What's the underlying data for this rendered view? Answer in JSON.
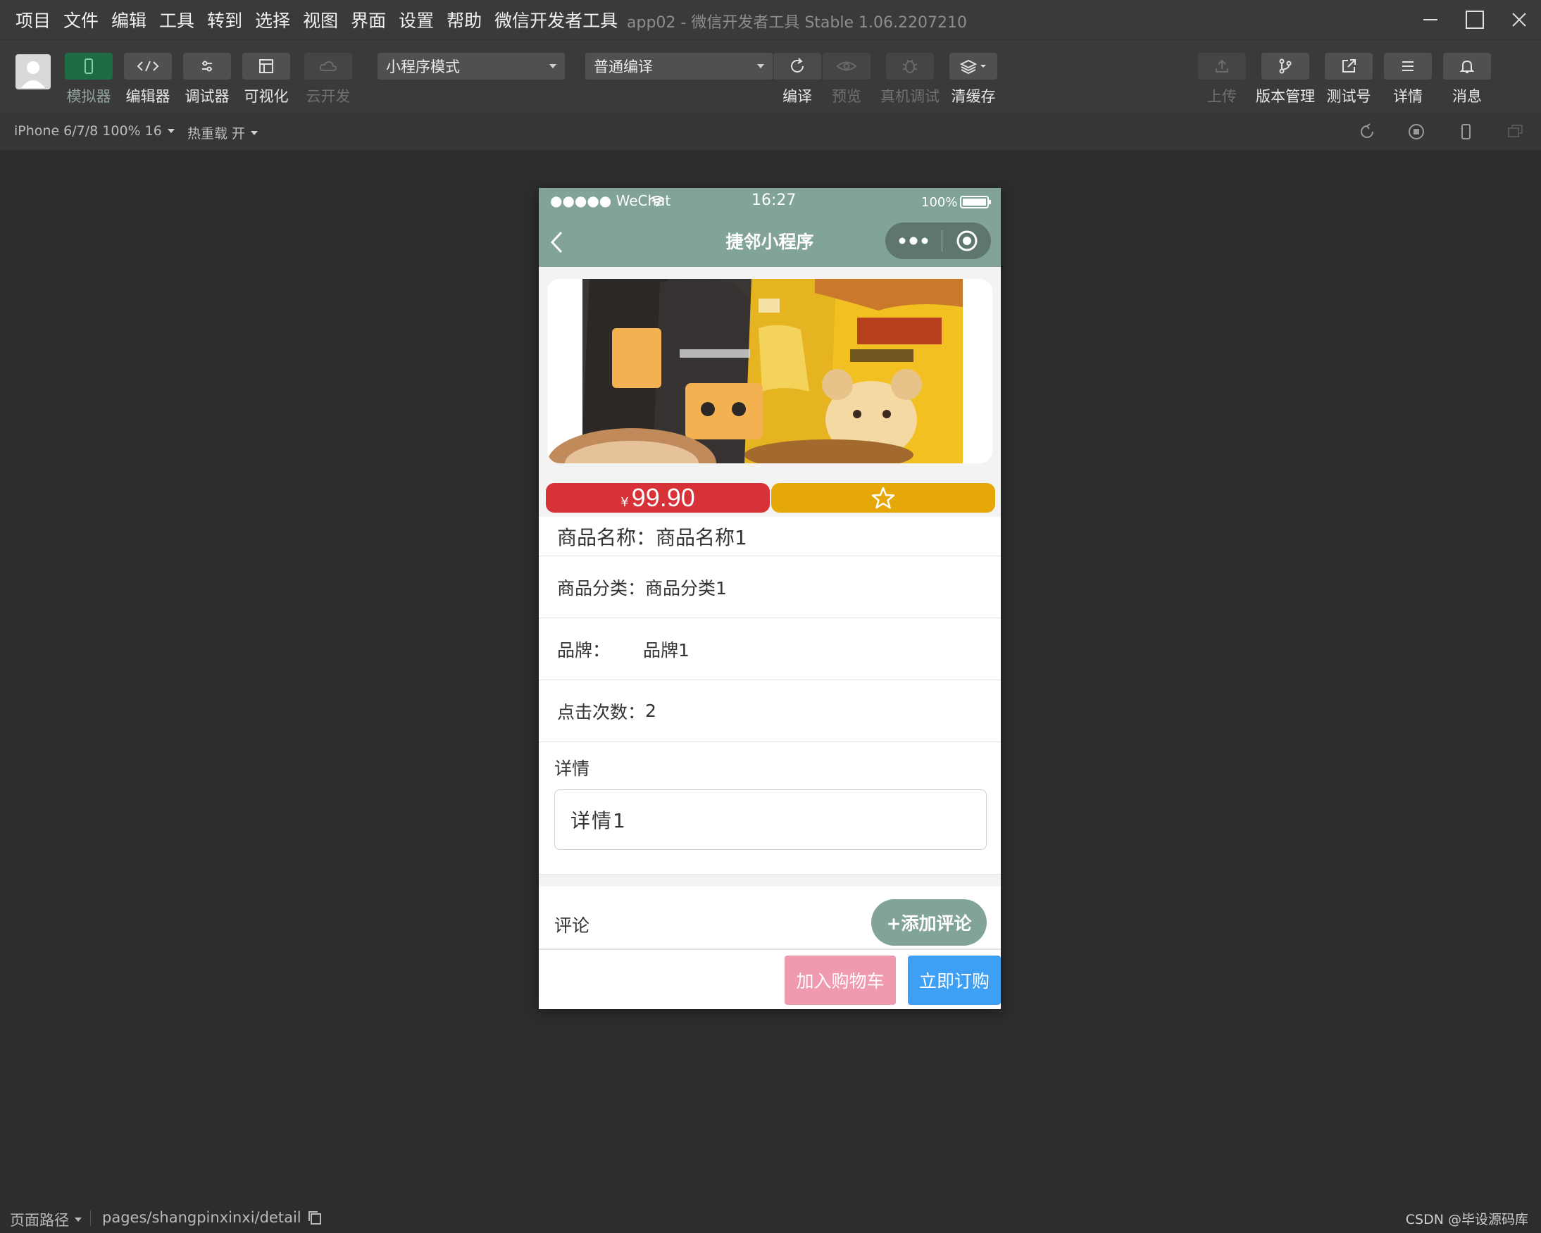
{
  "menubar": {
    "items": [
      "项目",
      "文件",
      "编辑",
      "工具",
      "转到",
      "选择",
      "视图",
      "界面",
      "设置",
      "帮助",
      "微信开发者工具"
    ],
    "title": "app02 - 微信开发者工具 Stable 1.06.2207210"
  },
  "toolbar": {
    "left_buttons": [
      {
        "label": "模拟器",
        "icon": "phone-icon"
      },
      {
        "label": "编辑器",
        "icon": "code-icon"
      },
      {
        "label": "调试器",
        "icon": "sliders-icon"
      },
      {
        "label": "可视化",
        "icon": "layout-icon"
      },
      {
        "label": "云开发",
        "icon": "cloud-icon"
      }
    ],
    "mode_select": "小程序模式",
    "compile_select": "普通编译",
    "mid_buttons": [
      {
        "label": "编译",
        "icon": "refresh-icon"
      },
      {
        "label": "预览",
        "icon": "eye-icon"
      },
      {
        "label": "真机调试",
        "icon": "bug-icon"
      },
      {
        "label": "清缓存",
        "icon": "layers-icon"
      }
    ],
    "right_buttons": [
      {
        "label": "上传",
        "icon": "upload-icon"
      },
      {
        "label": "版本管理",
        "icon": "branch-icon"
      },
      {
        "label": "测试号",
        "icon": "external-link-icon"
      },
      {
        "label": "详情",
        "icon": "menu-icon"
      },
      {
        "label": "消息",
        "icon": "bell-icon"
      }
    ]
  },
  "simbar": {
    "device": "iPhone 6/7/8 100% 16",
    "hot_reload": "热重载 开"
  },
  "phone": {
    "status": {
      "carrier": "●●●●● WeChat",
      "time": "16:27",
      "battery": "100%"
    },
    "nav_title": "捷邻小程序",
    "price_symbol": "¥",
    "price": "99.90",
    "product_name_label": "商品名称：",
    "product_name": "商品名称1",
    "category_label": "商品分类：",
    "category": "商品分类1",
    "brand_label": "品牌：",
    "brand": "品牌1",
    "clicks_label": "点击次数：",
    "clicks": "2",
    "detail_title": "详情",
    "detail_text": "详情1",
    "comment_title": "评论",
    "add_comment": "+添加评论",
    "add_to_cart": "加入购物车",
    "buy_now": "立即订购"
  },
  "footer": {
    "path_label": "页面路径",
    "path": "pages/shangpinxinxi/detail",
    "watermark": "CSDN @毕设源码库"
  },
  "colors": {
    "accent": "#82a39a",
    "price_red": "#d63238",
    "fav_yellow": "#e6a808",
    "cart_pink": "#ef9aae",
    "buy_blue": "#3ea0f5",
    "active_green": "#1f6b46"
  }
}
